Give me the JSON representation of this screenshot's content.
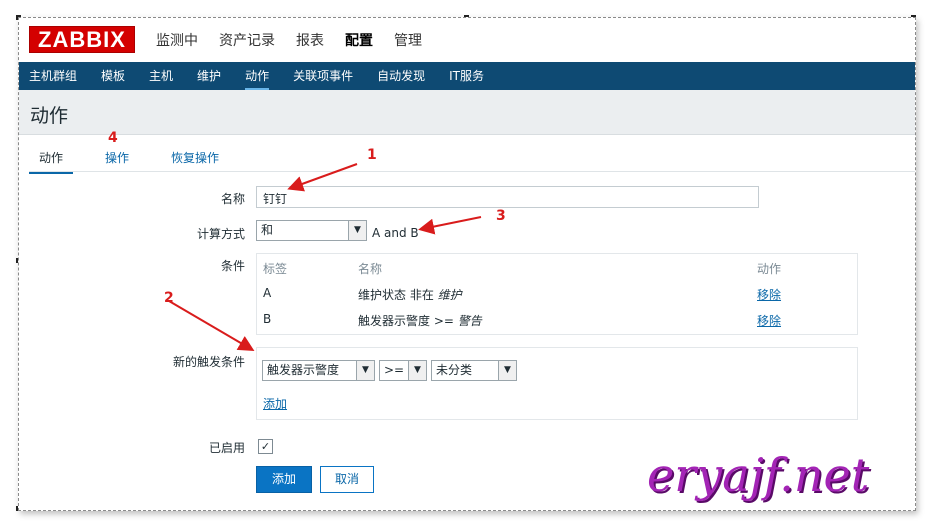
{
  "header": {
    "logo": "ZABBIX",
    "main_nav": [
      "监测中",
      "资产记录",
      "报表",
      "配置",
      "管理"
    ],
    "main_nav_active": "配置"
  },
  "sub_nav": {
    "items": [
      "主机群组",
      "模板",
      "主机",
      "维护",
      "动作",
      "关联项事件",
      "自动发现",
      "IT服务"
    ],
    "active": "动作"
  },
  "page": {
    "title": "动作"
  },
  "tabs": {
    "items": [
      "动作",
      "操作",
      "恢复操作"
    ],
    "active": "动作"
  },
  "form": {
    "name_label": "名称",
    "name_value": "钉钉",
    "calc_label": "计算方式",
    "calc_value": "和",
    "calc_formula": "A and B",
    "conditions_label": "条件",
    "conditions_headers": {
      "label": "标签",
      "name": "名称",
      "action": "动作"
    },
    "conditions": [
      {
        "label": "A",
        "name_plain": "维护状态 非在 ",
        "name_italic": "维护",
        "action": "移除"
      },
      {
        "label": "B",
        "name_plain": "触发器示警度 >= ",
        "name_italic": "警告",
        "action": "移除"
      }
    ],
    "new_condition_label": "新的触发条件",
    "new_condition_type": "触发器示警度",
    "new_condition_operator": ">=",
    "new_condition_value": "未分类",
    "add_link": "添加",
    "enabled_label": "已启用",
    "enabled": true,
    "submit_button": "添加",
    "cancel_button": "取消"
  },
  "annotations": [
    "1",
    "2",
    "3",
    "4"
  ],
  "watermark": "eryajf.net",
  "colors": {
    "logo_bg": "#d40000",
    "subnav_bg": "#0e4a73",
    "primary_button": "#0a74c4",
    "link": "#0a67a8",
    "annotation": "#d91c1c",
    "watermark": "#a324b5"
  }
}
